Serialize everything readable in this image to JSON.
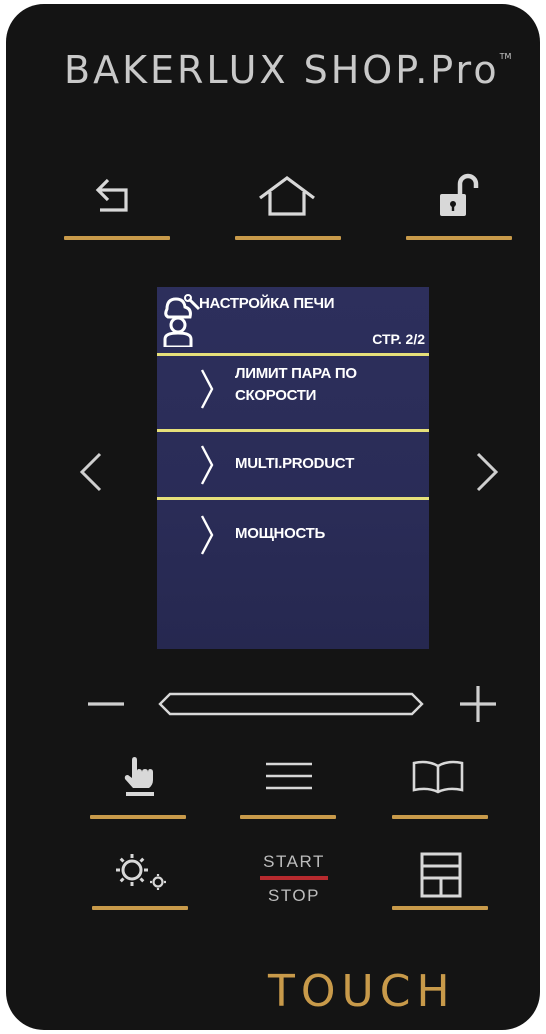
{
  "brand": {
    "name": "BAKERLUX SHOP.Pro",
    "trademark": "TM"
  },
  "top_buttons": [
    {
      "name": "back",
      "icon": "back-arrow-icon"
    },
    {
      "name": "home",
      "icon": "home-icon"
    },
    {
      "name": "lock",
      "icon": "unlocked-padlock-icon"
    }
  ],
  "screen": {
    "title": "НАСТРОЙКА ПЕЧИ",
    "page": "СТР. 2/2",
    "header_icon": "chef-wrench-icon",
    "items": [
      {
        "label": "ЛИМИТ ПАРА ПО\nСКОРОСТИ"
      },
      {
        "label": "MULTI.PRODUCT"
      },
      {
        "label": "МОЩНОСТЬ"
      }
    ]
  },
  "navigation": {
    "left_icon": "chevron-left-icon",
    "right_icon": "chevron-right-icon"
  },
  "slider": {
    "minus_icon": "minus-icon",
    "plus_icon": "plus-icon"
  },
  "bottom_buttons_row1": [
    {
      "name": "manual",
      "icon": "hand-pointer-icon"
    },
    {
      "name": "menu",
      "icon": "hamburger-menu-icon"
    },
    {
      "name": "recipes",
      "icon": "open-book-icon"
    }
  ],
  "bottom_buttons_row2": [
    {
      "name": "settings",
      "icon": "gears-icon"
    },
    {
      "name": "start_stop",
      "start_label": "START",
      "stop_label": "STOP"
    },
    {
      "name": "multi_tray",
      "icon": "trays-grid-icon"
    }
  ],
  "footer": {
    "logo": "TOUCH"
  },
  "colors": {
    "panel": "#141414",
    "accent_gold": "#c89a4a",
    "screen_bg": "#2b2e5a",
    "divider_yellow": "#e6e07a",
    "start_stop_red": "#b72a2e"
  }
}
